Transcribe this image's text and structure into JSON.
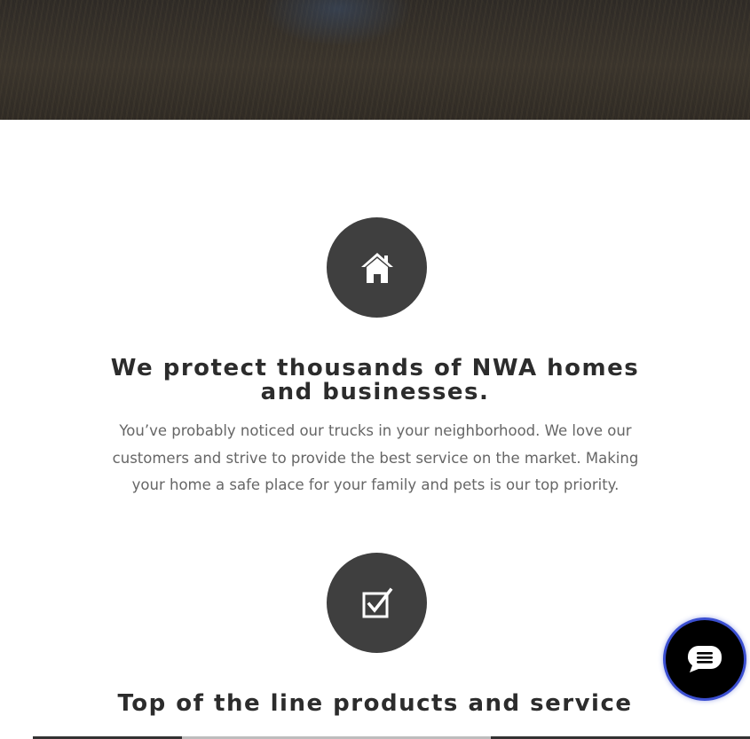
{
  "hero": {
    "image_description_icon": "grass-field-photo"
  },
  "features": [
    {
      "icon": "home-icon",
      "heading": "We protect thousands of NWA homes and businesses.",
      "body": "You’ve probably noticed our trucks in your neighborhood. We love our customers and strive to provide the best service on the market. Making your home a safe place for your family and pets is our top priority."
    },
    {
      "icon": "checkbox-icon",
      "heading": "Top of the line products and service",
      "body": ""
    }
  ],
  "chat": {
    "icon": "chat-bubble-icon"
  },
  "colors": {
    "icon_circle": "#3f3f3f",
    "heading": "#2c2c2c",
    "body": "#666666",
    "chat_ring": "#3b4fd1"
  }
}
